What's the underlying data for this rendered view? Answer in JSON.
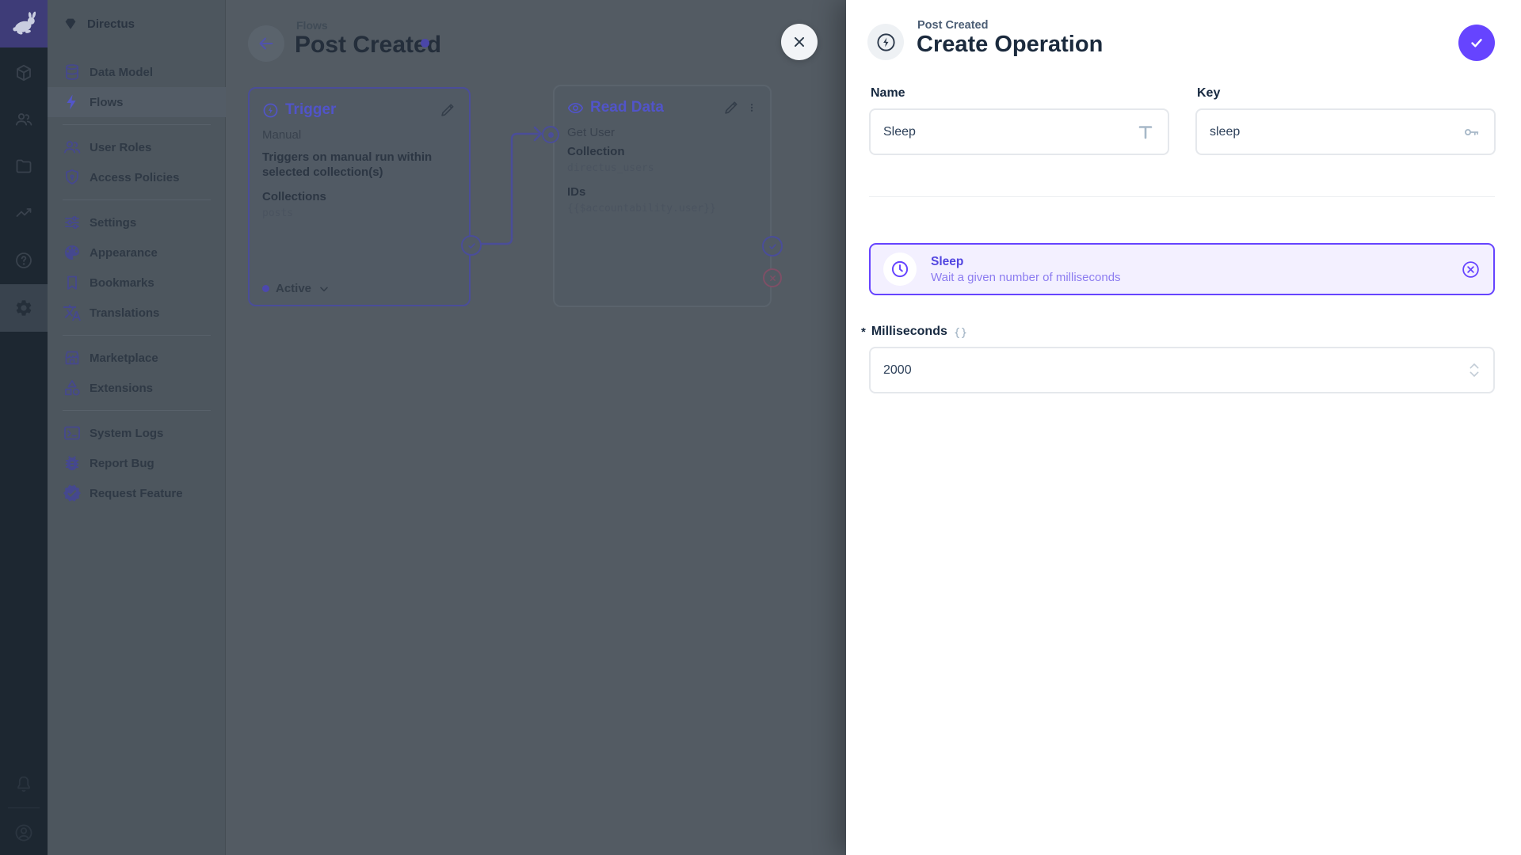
{
  "app": {
    "accent_color": "#6644ff",
    "overlay": "dimmed left workspace behind drawer"
  },
  "sidebar": {
    "project": "Directus",
    "items": [
      {
        "label": "Data Model"
      },
      {
        "label": "Flows",
        "active": true
      },
      {
        "label": "User Roles"
      },
      {
        "label": "Access Policies"
      },
      {
        "label": "Settings"
      },
      {
        "label": "Appearance"
      },
      {
        "label": "Bookmarks"
      },
      {
        "label": "Translations"
      },
      {
        "label": "Marketplace"
      },
      {
        "label": "Extensions"
      },
      {
        "label": "System Logs"
      },
      {
        "label": "Report Bug"
      },
      {
        "label": "Request Feature"
      }
    ]
  },
  "flow": {
    "breadcrumb": "Flows",
    "title": "Post Created",
    "trigger": {
      "title": "Trigger",
      "type": "Manual",
      "description": "Triggers on manual run within selected collection(s)",
      "collections_label": "Collections",
      "collections_value": "posts",
      "status": "Active"
    },
    "read_data": {
      "title": "Read Data",
      "name": "Get User",
      "collection_label": "Collection",
      "collection_value": "directus_users",
      "ids_label": "IDs",
      "ids_value": "{{$accountability.user}}"
    }
  },
  "drawer": {
    "breadcrumb": "Post Created",
    "title": "Create Operation",
    "name_field": {
      "label": "Name",
      "value": "Sleep"
    },
    "key_field": {
      "label": "Key",
      "value": "sleep"
    },
    "operation": {
      "name": "Sleep",
      "description": "Wait a given number of milliseconds"
    },
    "milliseconds": {
      "required": "*",
      "label": "Milliseconds",
      "value": "2000"
    }
  }
}
